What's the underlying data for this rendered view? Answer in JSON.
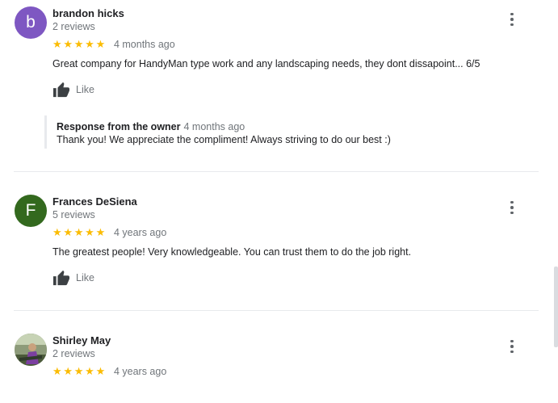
{
  "colors": {
    "star": "#fbbc04",
    "secondary_text": "#70757a"
  },
  "reviews": [
    {
      "avatar_initial": "b",
      "avatar_color": "#7e57c2",
      "name": "brandon hicks",
      "review_count": "2 reviews",
      "rating": 5,
      "date": "4 months ago",
      "text": "Great company for HandyMan type work and any landscaping needs, they dont dissapoint... 6/5",
      "like_label": "Like",
      "owner_response": {
        "title": "Response from the owner",
        "date": "4 months ago",
        "text": "Thank you! We appreciate the compliment! Always striving to do our best :)"
      }
    },
    {
      "avatar_initial": "F",
      "avatar_color": "#33691e",
      "name": "Frances DeSiena",
      "review_count": "5 reviews",
      "rating": 5,
      "date": "4 years ago",
      "text": "The greatest people! Very knowledgeable. You can trust them to do the job right.",
      "like_label": "Like"
    },
    {
      "avatar_initial": "",
      "avatar_icon": "profile-photo",
      "name": "Shirley May",
      "review_count": "2 reviews",
      "rating": 5,
      "date": "4 years ago"
    }
  ]
}
